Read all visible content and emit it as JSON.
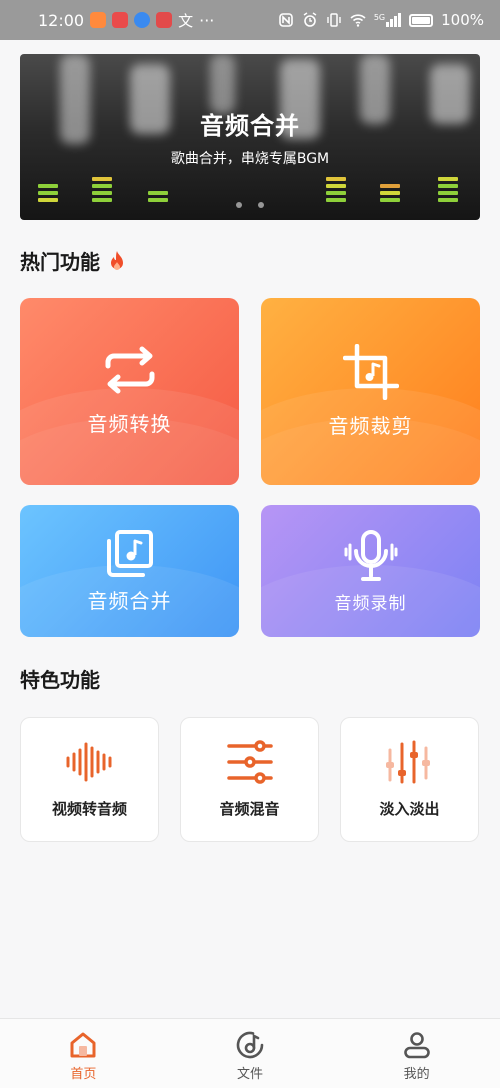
{
  "status_bar": {
    "time": "12:00",
    "more": "···",
    "network": "5G",
    "battery": "100%"
  },
  "banner": {
    "title": "音频合并",
    "subtitle": "歌曲合并，串烧专属BGM",
    "page_count": 2
  },
  "hot": {
    "title": "热门功能",
    "cards": [
      {
        "label": "音频转换",
        "icon": "convert-arrows-icon",
        "color_from": "#ff8a6a",
        "color_to": "#f55a43"
      },
      {
        "label": "音频裁剪",
        "icon": "crop-music-icon",
        "color_from": "#ffb142",
        "color_to": "#ff7e1d"
      },
      {
        "label": "音频合并",
        "icon": "music-library-icon",
        "color_from": "#6cc4ff",
        "color_to": "#3f95f5"
      },
      {
        "label": "音频录制",
        "icon": "microphone-icon",
        "color_from": "#b795f5",
        "color_to": "#7c82f3"
      }
    ]
  },
  "special": {
    "title": "特色功能",
    "items": [
      {
        "label": "视频转音频",
        "icon": "waveform-icon"
      },
      {
        "label": "音频混音",
        "icon": "mixer-sliders-icon"
      },
      {
        "label": "淡入淡出",
        "icon": "fade-faders-icon"
      }
    ]
  },
  "nav": {
    "items": [
      {
        "label": "首页",
        "icon": "home-icon",
        "active": true
      },
      {
        "label": "文件",
        "icon": "music-disc-icon",
        "active": false
      },
      {
        "label": "我的",
        "icon": "user-icon",
        "active": false
      }
    ]
  },
  "colors": {
    "accent": "#e8642b",
    "status_bar": "#9a9a9a"
  }
}
